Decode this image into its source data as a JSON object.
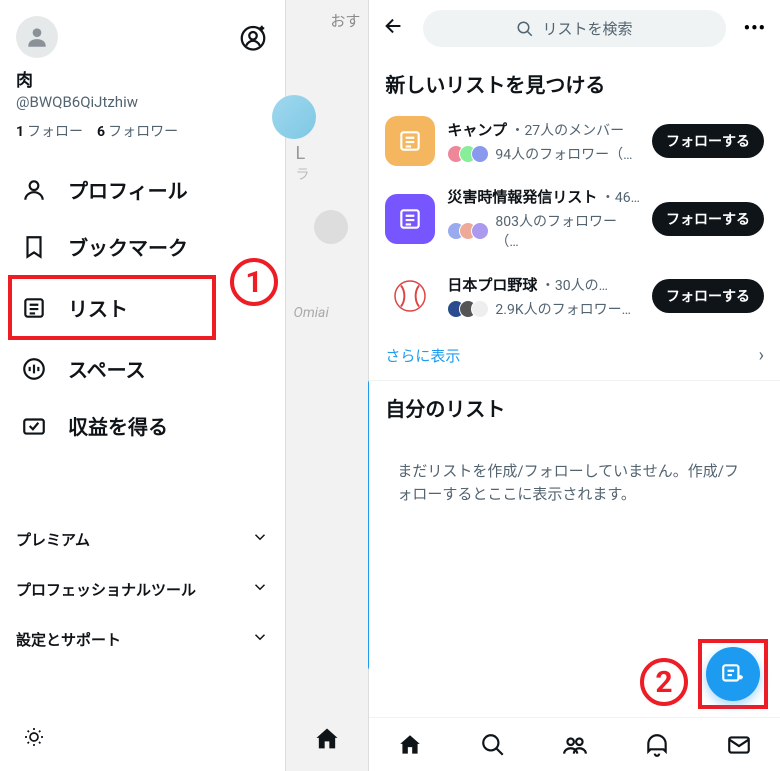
{
  "left": {
    "userName": "肉",
    "userHandle": "@BWQB6QiJtzhiw",
    "followingCount": "1",
    "followingLabel": "フォロー",
    "followersCount": "6",
    "followersLabel": "フォロワー",
    "nav": {
      "profile": "プロフィール",
      "bookmarks": "ブックマーク",
      "lists": "リスト",
      "spaces": "スペース",
      "monetization": "収益を得る"
    },
    "secondary": {
      "premium": "プレミアム",
      "professional": "プロフェッショナルツール",
      "settings": "設定とサポート"
    }
  },
  "middle": {
    "recommend": "おす",
    "blurChar": "L",
    "omiai": "Omiai"
  },
  "right": {
    "searchPlaceholder": "リストを検索",
    "discoverTitle": "新しいリストを見つける",
    "items": [
      {
        "name": "キャンプ",
        "members": "・27人のメンバー",
        "followers": "94人のフォロワー（…",
        "followBtn": "フォローする",
        "thumbColor": "orange"
      },
      {
        "name": "災害時情報発信リスト",
        "members": "・46…",
        "followers": "803人のフォロワー（…",
        "followBtn": "フォローする",
        "thumbColor": "purple"
      },
      {
        "name": "日本プロ野球",
        "members": "・30人の…",
        "followers": "2.9K人のフォロワー…",
        "followBtn": "フォローする",
        "thumbColor": "orange",
        "hasBaseball": true
      }
    ],
    "showMore": "さらに表示",
    "yourListsTitle": "自分のリスト",
    "emptyMessage": "まだリストを作成/フォローしていません。作成/フォローするとここに表示されます。"
  },
  "annotations": {
    "one": "1",
    "two": "2"
  }
}
